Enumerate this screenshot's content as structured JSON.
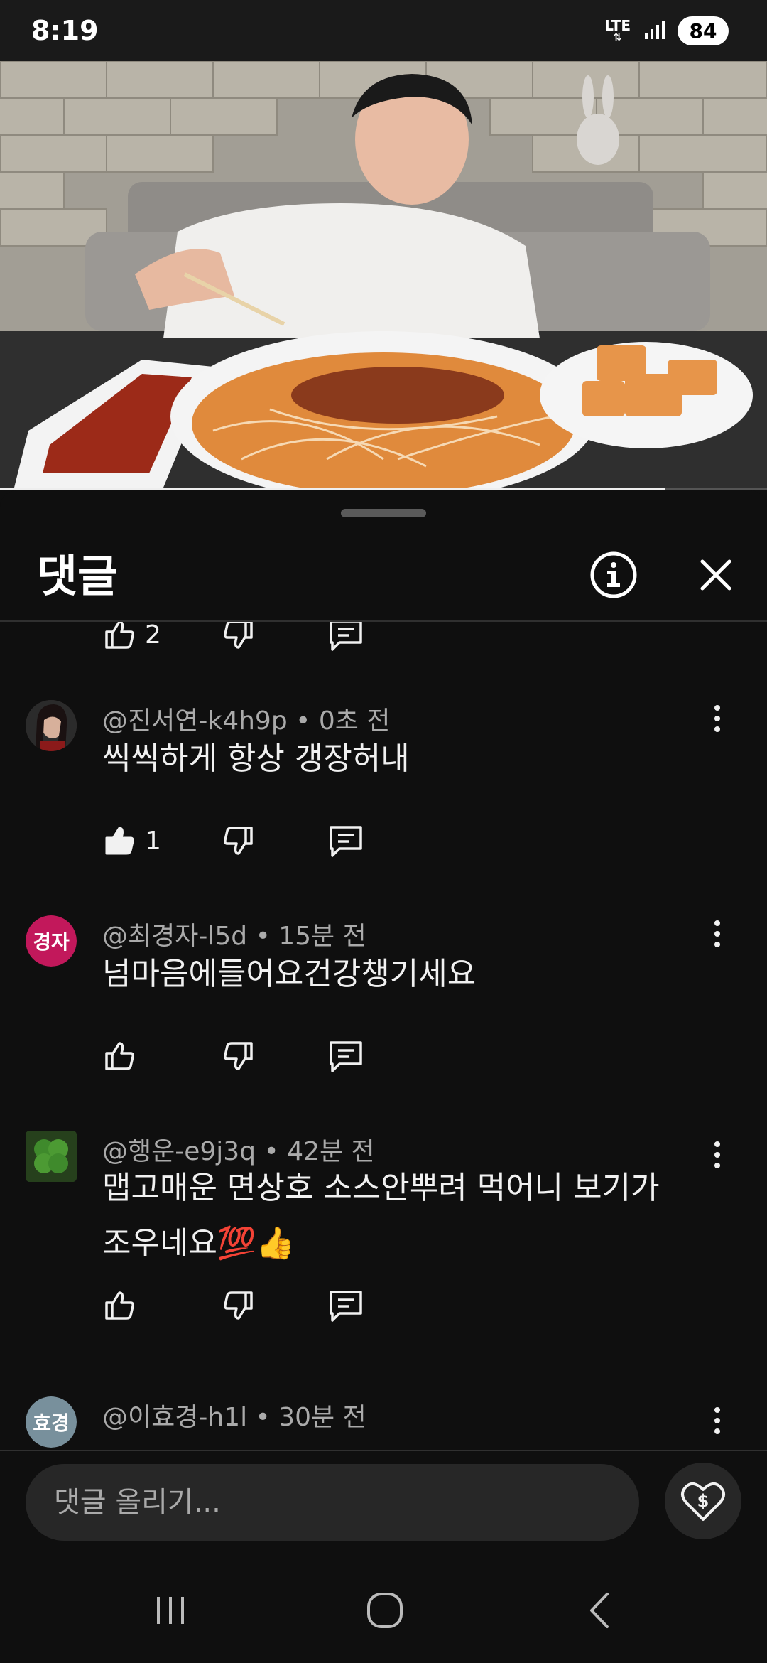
{
  "status_bar": {
    "time": "8:19",
    "network_label": "LTE",
    "battery": "84"
  },
  "video": {
    "progress_fraction": 0.868
  },
  "comments_panel": {
    "title": "댓글",
    "info_icon": "info-icon",
    "close_icon": "close-icon",
    "previous_comment_like_count": "2",
    "comments": [
      {
        "author": "@진서연-k4h9p",
        "time": "0초 전",
        "text": "씩씩하게 항상 갱장허내",
        "likes": "1",
        "avatar_type": "photo"
      },
      {
        "author": "@최경자-l5d",
        "time": "15분 전",
        "text": "넘마음에들어요건강챙기세요",
        "likes": "",
        "avatar_text": "경자",
        "avatar_color": "#c2185b"
      },
      {
        "author": "@행운-e9j3q",
        "time": "42분 전",
        "text_line1": "맵고매운 면상호 소스안뿌려 먹어니 보기가",
        "text_line2": "조우네요💯👍",
        "likes": "",
        "avatar_type": "clover"
      },
      {
        "author": "@이효경-h1l",
        "time": "30분 전",
        "avatar_text": "효경",
        "avatar_color": "#78909c"
      }
    ]
  },
  "composer": {
    "placeholder": "댓글 올리기...",
    "thanks_icon": "super-thanks-heart-icon"
  },
  "nav_bar": {
    "recents_icon": "recents-icon",
    "home_icon": "home-icon",
    "back_icon": "back-icon"
  }
}
